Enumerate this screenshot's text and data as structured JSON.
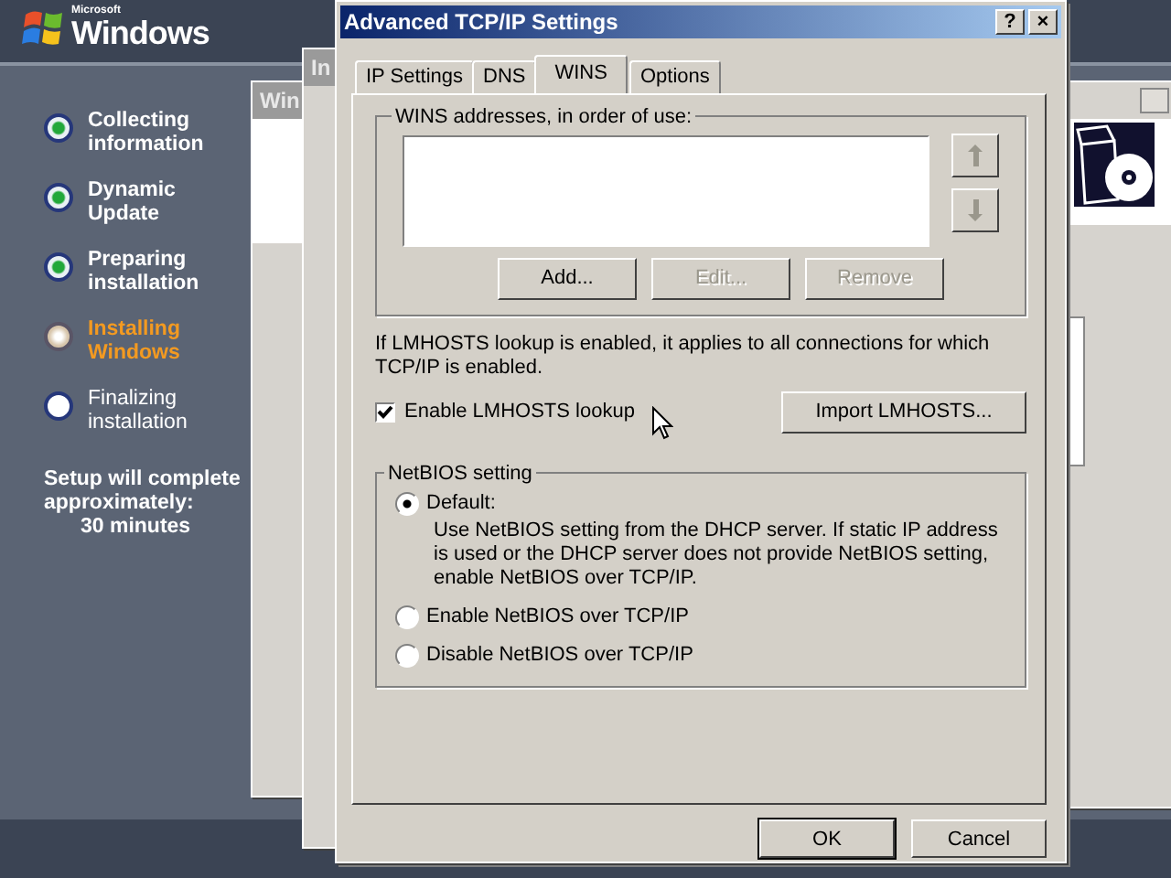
{
  "setup_sidebar": {
    "steps": [
      {
        "label": "Collecting information",
        "kind": "done"
      },
      {
        "label": "Dynamic Update",
        "kind": "done"
      },
      {
        "label": "Preparing installation",
        "kind": "done"
      },
      {
        "label": "Installing Windows",
        "kind": "current"
      },
      {
        "label": "Finalizing installation",
        "kind": "pending"
      }
    ],
    "estimate": [
      "Setup will complete",
      "approximately:",
      "30 minutes"
    ]
  },
  "logo": {
    "small_text": "Microsoft",
    "text": "Windows"
  },
  "background_windows": [
    {
      "title": "Win"
    },
    {
      "title": "In"
    }
  ],
  "dialog": {
    "title": "Advanced TCP/IP Settings",
    "title_buttons": [
      "?",
      "×"
    ],
    "tabs": [
      {
        "label": "IP Settings",
        "selected": false
      },
      {
        "label": "DNS",
        "selected": false
      },
      {
        "label": "WINS",
        "selected": true
      },
      {
        "label": "Options",
        "selected": false
      }
    ],
    "wins_group": {
      "title": "WINS addresses, in order of use:",
      "buttons": [
        {
          "label": "Add...",
          "disabled": false
        },
        {
          "label": "Edit...",
          "disabled": true
        },
        {
          "label": "Remove",
          "disabled": true
        }
      ]
    },
    "lmhosts_note": "If LMHOSTS lookup is enabled, it applies to all connections for which TCP/IP is enabled.",
    "lmhosts_checkbox": {
      "label": "Enable LMHOSTS lookup",
      "checked": true
    },
    "import_button": "Import LMHOSTS...",
    "netbios_group": {
      "title": "NetBIOS setting",
      "options": [
        {
          "label": "Default:",
          "selected": true,
          "description": "Use NetBIOS setting from the DHCP server. If static IP address is used or the DHCP server does not provide NetBIOS setting, enable NetBIOS over TCP/IP."
        },
        {
          "label": "Enable NetBIOS over TCP/IP",
          "selected": false
        },
        {
          "label": "Disable NetBIOS over TCP/IP",
          "selected": false
        }
      ]
    },
    "buttons": [
      "OK",
      "Cancel"
    ]
  }
}
